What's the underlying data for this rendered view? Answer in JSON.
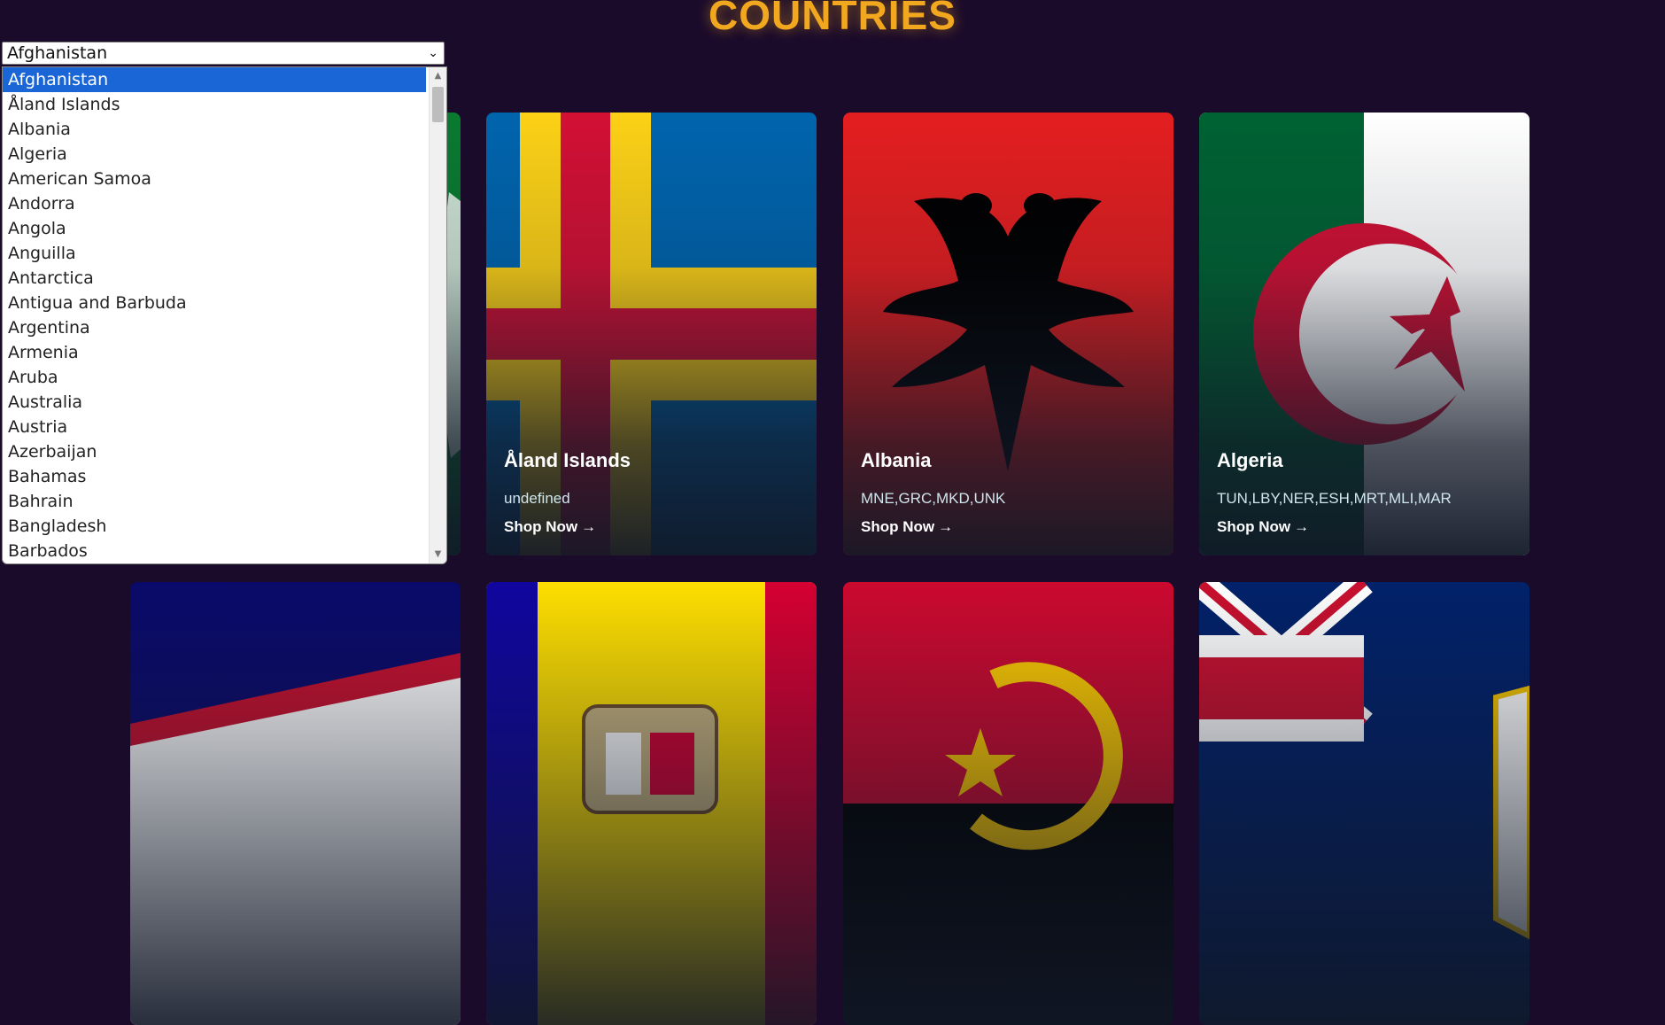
{
  "header": {
    "title": "COUNTRIES"
  },
  "select": {
    "value": "Afghanistan",
    "options": [
      "Afghanistan",
      "Åland Islands",
      "Albania",
      "Algeria",
      "American Samoa",
      "Andorra",
      "Angola",
      "Anguilla",
      "Antarctica",
      "Antigua and Barbuda",
      "Argentina",
      "Armenia",
      "Aruba",
      "Australia",
      "Austria",
      "Azerbaijan",
      "Bahamas",
      "Bahrain",
      "Bangladesh",
      "Barbados"
    ]
  },
  "cards": [
    {
      "name": "Åland Islands",
      "borders": "undefined",
      "link": "Shop Now",
      "arrow": "→"
    },
    {
      "name": "Albania",
      "borders": "MNE,GRC,MKD,UNK",
      "link": "Shop Now",
      "arrow": "→"
    },
    {
      "name": "Algeria",
      "borders": "TUN,LBY,NER,ESH,MRT,MLI,MAR",
      "link": "Shop Now",
      "arrow": "→"
    }
  ],
  "colors": {
    "background": "#1b0b2b",
    "title": "#f2a81e",
    "selected_option": "#1a66d6"
  }
}
